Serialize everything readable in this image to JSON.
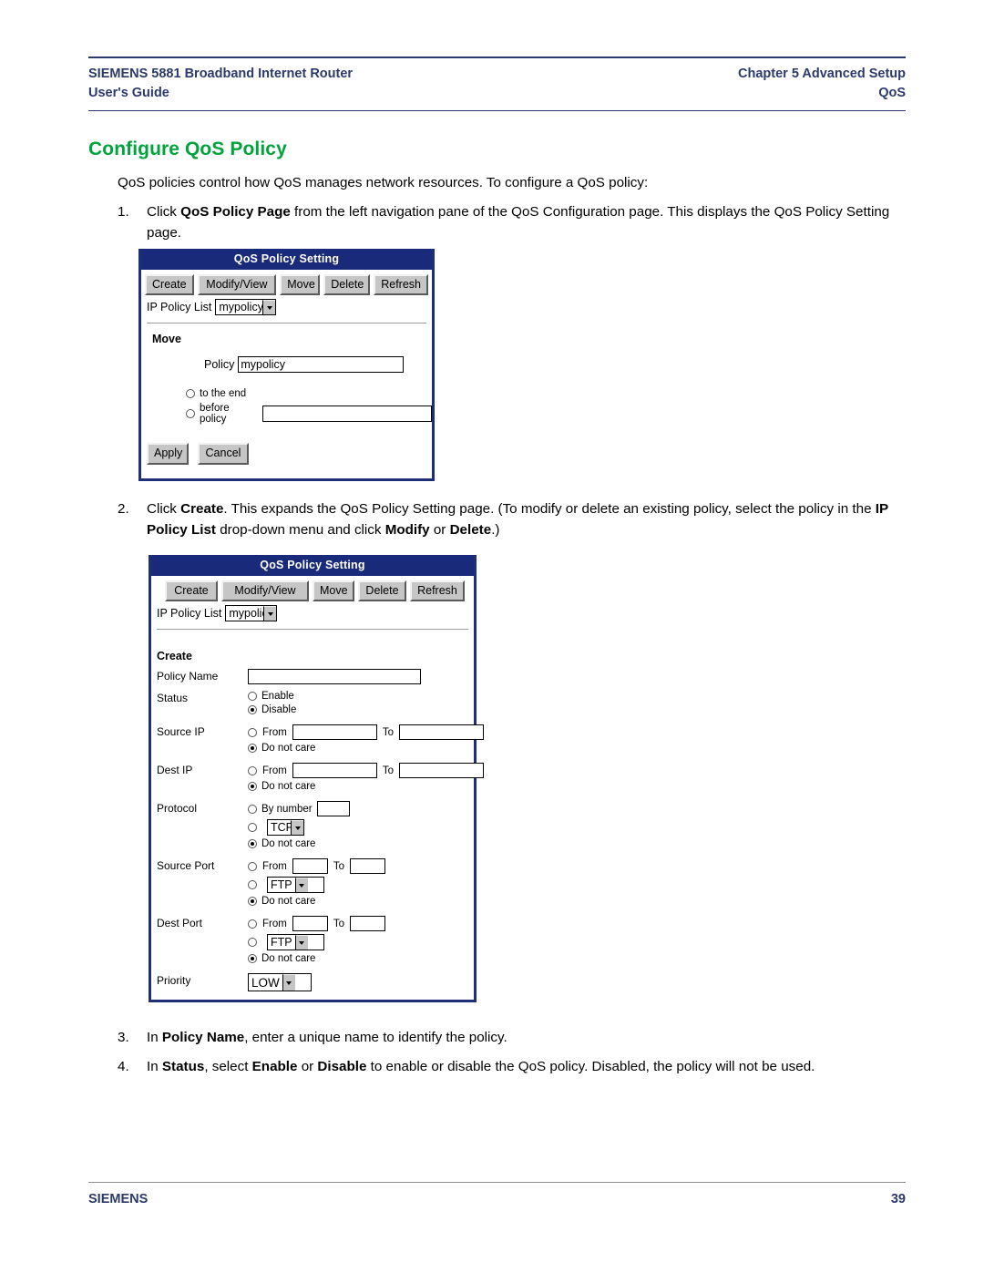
{
  "header": {
    "left_line1": "SIEMENS 5881 Broadband Internet Router",
    "left_line2": "User's Guide",
    "right_line1": "Chapter 5  Advanced Setup",
    "right_line2": "QoS",
    "color": "#2b3a6b"
  },
  "title": {
    "text": "Configure QoS Policy",
    "color": "#00a33c"
  },
  "intro": "QoS policies control how QoS manages network resources. To configure a QoS policy:",
  "steps": [
    {
      "num": "1.",
      "parts": [
        {
          "t": "Click ",
          "b": false
        },
        {
          "t": "QoS Policy Page",
          "b": true
        },
        {
          "t": " from the left navigation pane of the QoS Configuration page. This displays the QoS Policy Setting page.",
          "b": false
        }
      ]
    },
    {
      "num": "2.",
      "parts": [
        {
          "t": "Click ",
          "b": false
        },
        {
          "t": "Create",
          "b": true
        },
        {
          "t": ". This expands the QoS Policy Setting page. (To modify or delete an existing policy, select the policy in the ",
          "b": false
        },
        {
          "t": "IP Policy List",
          "b": true
        },
        {
          "t": " drop-down menu and click ",
          "b": false
        },
        {
          "t": "Modify",
          "b": true
        },
        {
          "t": " or ",
          "b": false
        },
        {
          "t": "Delete",
          "b": true
        },
        {
          "t": ".)",
          "b": false
        }
      ]
    },
    {
      "num": "3.",
      "parts": [
        {
          "t": "In ",
          "b": false
        },
        {
          "t": "Policy Name",
          "b": true
        },
        {
          "t": ", enter a unique name to identify the policy.",
          "b": false
        }
      ]
    },
    {
      "num": "4.",
      "parts": [
        {
          "t": "In ",
          "b": false
        },
        {
          "t": "Status",
          "b": true
        },
        {
          "t": ", select ",
          "b": false
        },
        {
          "t": "Enable",
          "b": true
        },
        {
          "t": " or ",
          "b": false
        },
        {
          "t": "Disable",
          "b": true
        },
        {
          "t": " to enable or disable the QoS policy. Disabled, the policy will not be used.",
          "b": false
        }
      ]
    }
  ],
  "shot1": {
    "window_title": "QoS Policy Setting",
    "toolbar": [
      "Create",
      "Modify/View",
      "Move",
      "Delete",
      "Refresh"
    ],
    "ip_policy_list_label": "IP Policy List",
    "ip_policy_list_value": "mypolicy",
    "group_label": "Move",
    "policy_label": "Policy",
    "policy_value": "mypolicy",
    "radio_to_the_end": "to the end",
    "radio_before_policy": "before policy",
    "before_policy_value": "",
    "apply_label": "Apply",
    "cancel_label": "Cancel"
  },
  "shot2": {
    "window_title": "QoS Policy Setting",
    "toolbar": [
      "Create",
      "Modify/View",
      "Move",
      "Delete",
      "Refresh"
    ],
    "ip_policy_list_label": "IP Policy List",
    "ip_policy_list_value": "mypolic",
    "group_label": "Create",
    "policy_name_label": "Policy Name",
    "policy_name_value": "",
    "status_label": "Status",
    "status_enable": "Enable",
    "status_disable": "Disable",
    "source_ip_label": "Source IP",
    "dest_ip_label": "Dest IP",
    "from_label": "From",
    "to_label": "To",
    "do_not_care_label": "Do not care",
    "protocol_label": "Protocol",
    "protocol_by_number": "By number",
    "protocol_select_value": "TCP",
    "source_port_label": "Source Port",
    "source_port_select_value": "FTP",
    "dest_port_label": "Dest Port",
    "dest_port_select_value": "FTP",
    "priority_label": "Priority",
    "priority_value": "LOW"
  },
  "footer": {
    "brand": "SIEMENS",
    "page_number": "39"
  }
}
